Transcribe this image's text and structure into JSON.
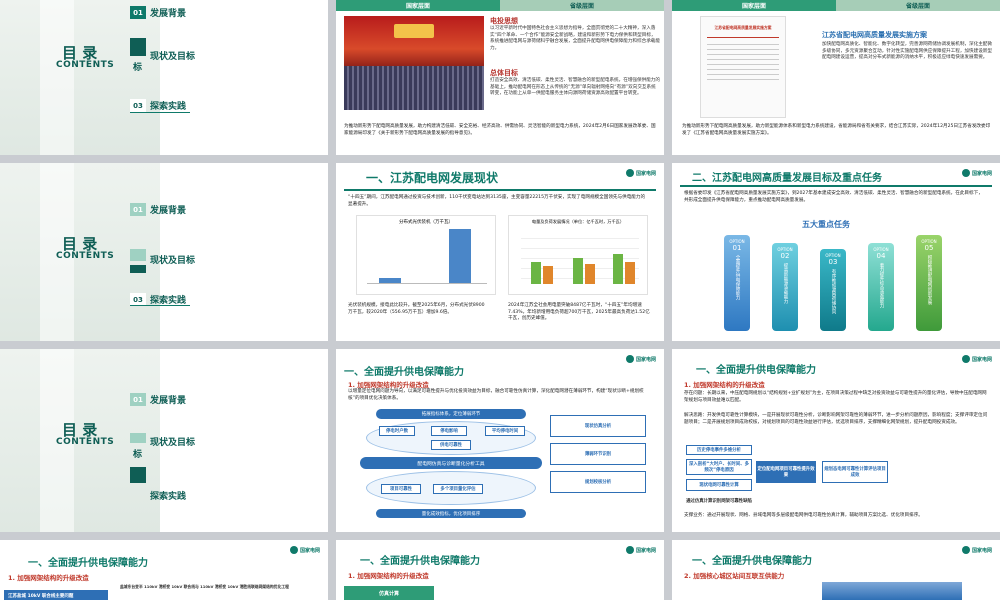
{
  "toc": {
    "title": "目 录",
    "subtitle": "CONTENTS",
    "items": [
      {
        "num": "01",
        "label": "发展背景"
      },
      {
        "num": "02",
        "label": "现状及目标"
      },
      {
        "num": "03",
        "label": "探索实践"
      }
    ],
    "item2_wrap": "标"
  },
  "slide2": {
    "tab_left": "国家层面",
    "tab_right": "省级层面",
    "h1": "电投思想",
    "p1": "以习近平新时代中国特色社会主义思想为指导，全面贯彻党的二十大精神，深入落实“四个革命、一个合作”能源安全新战略，建设和新形势下电力保供和转型目标，系统推进配电网与源荷储科学融合发展，全面提升配电网供电保障能力和综合承载能力。",
    "h2": "总体目标",
    "p2": "打造安全高效、清洁低碳、柔性灵活、智慧融合的新型配电系统，在增强保供能力的基础上，推动配电网在形态上从传统的“无源”单向辐射网络向“有源”双向交互系统转变，在功能上从单一供配电服务主体向源网荷储资源高效配置平台转变。",
    "note": "为推动新形势下配电网高质量发展，助力构建清洁低碳、安全充裕、经济高效、供需协同、灵活智能的新型电力系统，2024年2月6日国家发展改革委、国家能源局印发了《关于新形势下配电网高质量发展的指导意见》。"
  },
  "slide3": {
    "tab_left": "国家层面",
    "tab_right": "省级层面",
    "doc_title": "江苏省配电网高质量发展实施方案",
    "h1": "江苏省配电网高质量发展实施方案",
    "p1": "加快配电网高质化、智能化、数字化转型，完善源网荷储协调发展机制，深化主配微多级协同，多元资源聚合互动，针对性实施配电网供应保障提升工程，加快建设新型配电网建设运营，提高对分布式新能源的消纳水平，积极适应绿电快速发展需要。",
    "note": "为推动新形势下配电网高质量发展，助力新型能源体系和新型电力系统建设，省能源局和省有关要求，结合江苏实际，2024年12月25日江苏省发改委印发了《江苏省配电网高质量发展实施方案》。"
  },
  "slide5": {
    "title": "一、江苏配电网发展现状",
    "p1": "“十四五”期间，江苏配电网通过投资与技术创新，110千伏变电站达到3135座，主变容量22215万千伏安，实现了电网规模全国领先与供电能力的显著提升。",
    "chart1_title": "分布式光伏装机（万千瓦）",
    "chart2_title": "电量及负荷发展情况（单位：亿千瓦时，万千瓦）",
    "b1": "光伏装机规模，接电此比较升。截至2025年6月，分布式光伏8900万千瓦，较2020年（556.95万千瓦）增加9.6倍。",
    "b2": "2024年江苏全社会用电量突破8487亿千瓦时，“十四五”年均增速7.43%，年均新增用电负荷超700万千瓦，2025年最高负荷达1.52亿千瓦，创历史峰值。"
  },
  "slide6": {
    "title": "二、江苏配电网高质量发展目标及重点任务",
    "p1": "根据省委印发《江苏省配电网高质量发展实施方案》，到2027年基本建成安全高效、清洁低碳、柔性灵活、智慧融合的新型配电系统，在此目标下，共形成全面提升供电保障能力，重点推动配电网高质量发展。",
    "tasks_title": "五大重点任务",
    "options": [
      {
        "label": "OPTION",
        "num": "01",
        "text": "全面提升供电保障能力"
      },
      {
        "label": "OPTION",
        "num": "02",
        "text": "提高新能源承载能力"
      },
      {
        "label": "OPTION",
        "num": "03",
        "text": "有序推动源网荷储协同"
      },
      {
        "label": "OPTION",
        "num": "04",
        "text": "着力提升综合承载能力"
      },
      {
        "label": "OPTION",
        "num": "05",
        "text": "积极推进配电网创新发展"
      }
    ]
  },
  "slide8": {
    "title": "一、全面提升供电保障能力",
    "sub": "1. 加强网架结构的升级改造",
    "b1": "以增量定位电网问题为导向，以满足可靠性提升与优化投资效益为目标，融合可靠性仿真计算，深化配电网潜在薄弱环节，构建“现状诊断+规划校核”的项目优化决策体系。",
    "top_label": "拓展指标体系，定位薄弱环节",
    "flow_labels": [
      "停电时户数",
      "停电影响",
      "平均停电时间",
      "供电可靠性",
      "故障停电",
      "检修停电",
      "现状仿真分析",
      "规划校核分析",
      "方案比选",
      "薄弱环节识别",
      "投资效益评价",
      "运维策略提升",
      "项目可靠性",
      "多个项目量化评估"
    ],
    "mid_label": "配电网仿真与诊断量化分析工具",
    "bottom_label": "量化成效指标，优化项目排序"
  },
  "slide9": {
    "title": "一、全面提升供电保障能力",
    "sub": "1. 加强网架结构的升级改造",
    "b1": "存在问题：长期以来，中压配电网规划以“结构规划+业扩规划”为主，在项目决策过程中缺乏对投资效益与可靠性提升的量化评估，导致中压配电网网架规划与项目效益难以匹配。",
    "b2": "解决思路：开发供电可靠性计算模块，一是开展现状可靠性分析，诊断影响网架可靠性的薄弱环节，进一步分析问题原因，影响程度；支撑评审定位问题项目；二是开展规划项目成效校核，对规划项目的可靠性效益进行评估，优选项目排序，支撑精细化网架规划，提升配电网投资成效。",
    "flow": [
      "历史停电事件多维分析",
      "深入剖析“大时户、长时间、多频次”停电原因",
      "现状电网可靠性计算",
      "规划态电网可靠性计算评估项目成效",
      "通过仿真计算识别网架可靠性缺陷",
      "定位配电网项目可靠性提升效果"
    ],
    "b3": "支撑业务：通过开展现状、网格、县域电网等多层级配电网供电可靠性仿真计算，辅助项目方案比选、优化项目排序。"
  },
  "slide10": {
    "title": "一、全面提升供电保障能力",
    "sub": "1. 加强网架结构的升级改造",
    "table_head": "盐城东台变半 110kV 港桥变 10kV 联合线与 110kV 港桥变 10kV 港胜线联络网架结构优化工程",
    "left_label": "江苏盐城 10kV 联合线主要问题"
  },
  "slide11": {
    "title": "一、全面提升供电保障能力",
    "sub": "1. 加强网架结构的升级改造",
    "box": "仿真计算"
  },
  "slide12": {
    "title": "一、全面提升供电保障能力",
    "sub": "2. 加强核心城区站间互联互供能力"
  },
  "logo_text": "国家电网",
  "colors": {
    "brand": "#0f7a6a",
    "accent": "#2e9c77",
    "red": "#b5322c"
  }
}
